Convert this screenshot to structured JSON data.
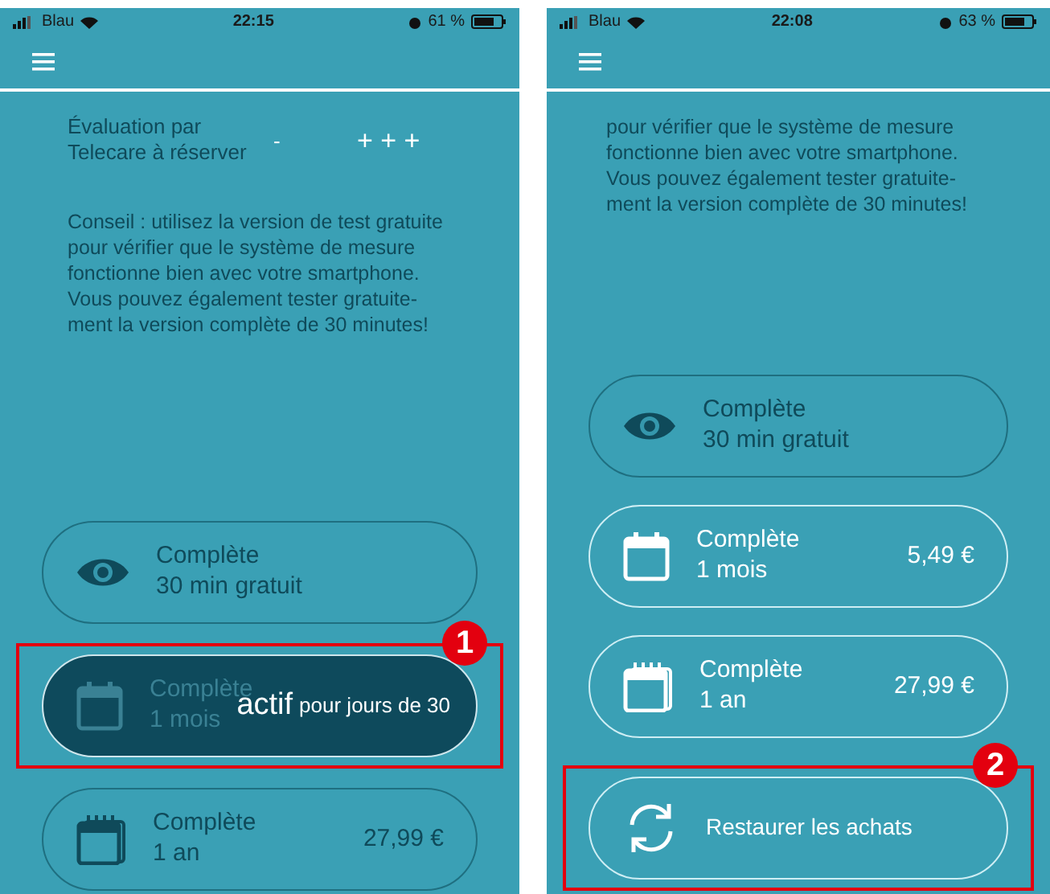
{
  "screens": [
    {
      "status_bar": {
        "carrier": "Blau",
        "time": "22:15",
        "battery": "61 %"
      },
      "rating": {
        "label": "Évaluation par Telecare à réserver",
        "value_1": "-",
        "value_2": "+ + +"
      },
      "tip": "Conseil : utilisez la version de test gratuite pour vérifier que le système de mesure fonctionne bien avec votre smartphone. Vous pouvez également tester gratuite-ment la version complète de 30 minutes!",
      "options": [
        {
          "kind": "free",
          "title": "Complète",
          "subtitle": "30 min gratuit",
          "disabled": true,
          "active": false
        },
        {
          "kind": "month",
          "title": "Complète",
          "subtitle": "1 mois",
          "active": true,
          "active_label": "actif",
          "active_detail": "pour jours de 30",
          "annotation": "1"
        },
        {
          "kind": "year",
          "title": "Complète",
          "subtitle": "1 an",
          "price": "27,99 €",
          "disabled": true,
          "active": false
        }
      ]
    },
    {
      "status_bar": {
        "carrier": "Blau",
        "time": "22:08",
        "battery": "63 %"
      },
      "tip": "pour vérifier que le système de mesure fonctionne bien avec votre smartphone. Vous pouvez également tester gratuite-ment la version complète de 30 minutes!",
      "options": [
        {
          "kind": "free",
          "title": "Complète",
          "subtitle": "30 min gratuit",
          "disabled": true,
          "active": false
        },
        {
          "kind": "month",
          "title": "Complète",
          "subtitle": "1 mois",
          "price": "5,49 €",
          "disabled": false,
          "active": false
        },
        {
          "kind": "year",
          "title": "Complète",
          "subtitle": "1 an",
          "price": "27,99 €",
          "disabled": false,
          "active": false
        },
        {
          "kind": "restore",
          "title": "Restaurer les achats",
          "disabled": false,
          "active": false,
          "annotation": "2"
        }
      ]
    }
  ]
}
